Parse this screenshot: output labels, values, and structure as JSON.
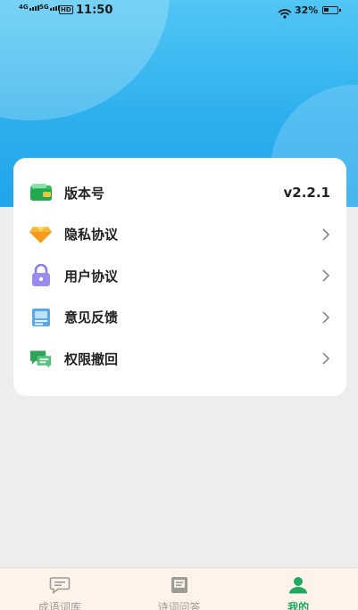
{
  "status_bar": {
    "signal1": "4G",
    "signal2": "5G",
    "hd": "HD",
    "time": "11:50",
    "battery_percent": "32%"
  },
  "menu": {
    "items": [
      {
        "label": "版本号",
        "value": "v2.2.1",
        "icon": "wallet-icon"
      },
      {
        "label": "隐私协议",
        "icon": "diamond-icon"
      },
      {
        "label": "用户协议",
        "icon": "lock-icon"
      },
      {
        "label": "意见反馈",
        "icon": "feedback-icon"
      },
      {
        "label": "权限撤回",
        "icon": "chat-icon"
      }
    ]
  },
  "bottom_nav": {
    "tabs": [
      {
        "label": "成语词库",
        "icon": "message-icon",
        "active": false
      },
      {
        "label": "诗词问答",
        "icon": "book-icon",
        "active": false
      },
      {
        "label": "我的",
        "icon": "user-icon",
        "active": true
      }
    ]
  },
  "colors": {
    "header_blue": "#2eb0ee",
    "active_green": "#1ea95e",
    "nav_bg": "#fdf3ea"
  }
}
